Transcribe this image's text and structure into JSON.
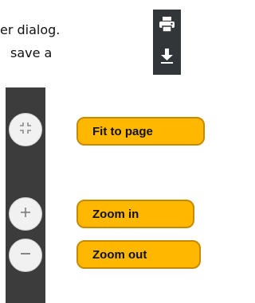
{
  "document": {
    "line1": "er dialog.",
    "line2": "save a"
  },
  "toolbar": {
    "icons": [
      "print-icon",
      "download-icon"
    ]
  },
  "controls": [
    {
      "icon": "fit-to-page-icon",
      "label": "Fit to page"
    },
    {
      "icon": "zoom-in-icon",
      "label": "Zoom in"
    },
    {
      "icon": "zoom-out-icon",
      "label": "Zoom out"
    }
  ],
  "colors": {
    "toolbar_bg": "#323639",
    "sidebar_bg": "#3c3c3c",
    "button_bg": "#f1f1f1",
    "tooltip_bg": "#ffb700",
    "tooltip_border": "#c48b00"
  }
}
